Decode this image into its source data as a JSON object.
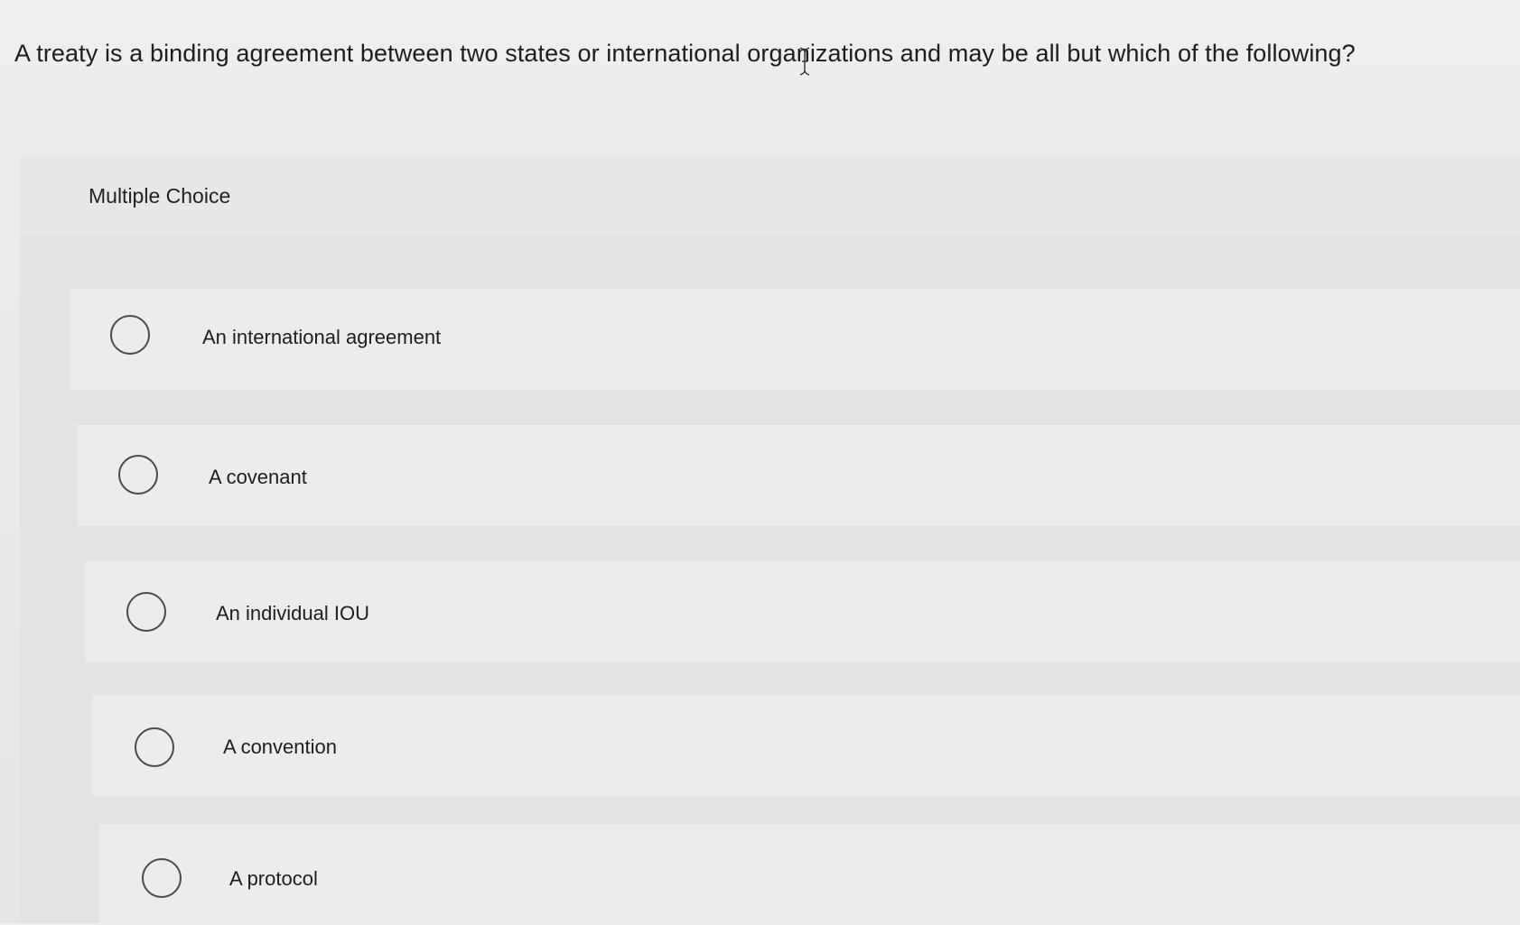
{
  "question": {
    "text": "A treaty is a binding agreement between two states or international organizations and may be all but which of the following?"
  },
  "panel": {
    "label": "Multiple Choice"
  },
  "options": [
    {
      "label": "An international agreement",
      "selected": false
    },
    {
      "label": "A covenant",
      "selected": false
    },
    {
      "label": "An individual IOU",
      "selected": false
    },
    {
      "label": "A convention",
      "selected": false
    },
    {
      "label": "A protocol",
      "selected": false
    }
  ],
  "colors": {
    "background": "#eeeeee",
    "panel": "#e3e3e3",
    "option_row": "#ececec",
    "text": "#1d1d1d",
    "radio_border": "#4a4a4a"
  }
}
